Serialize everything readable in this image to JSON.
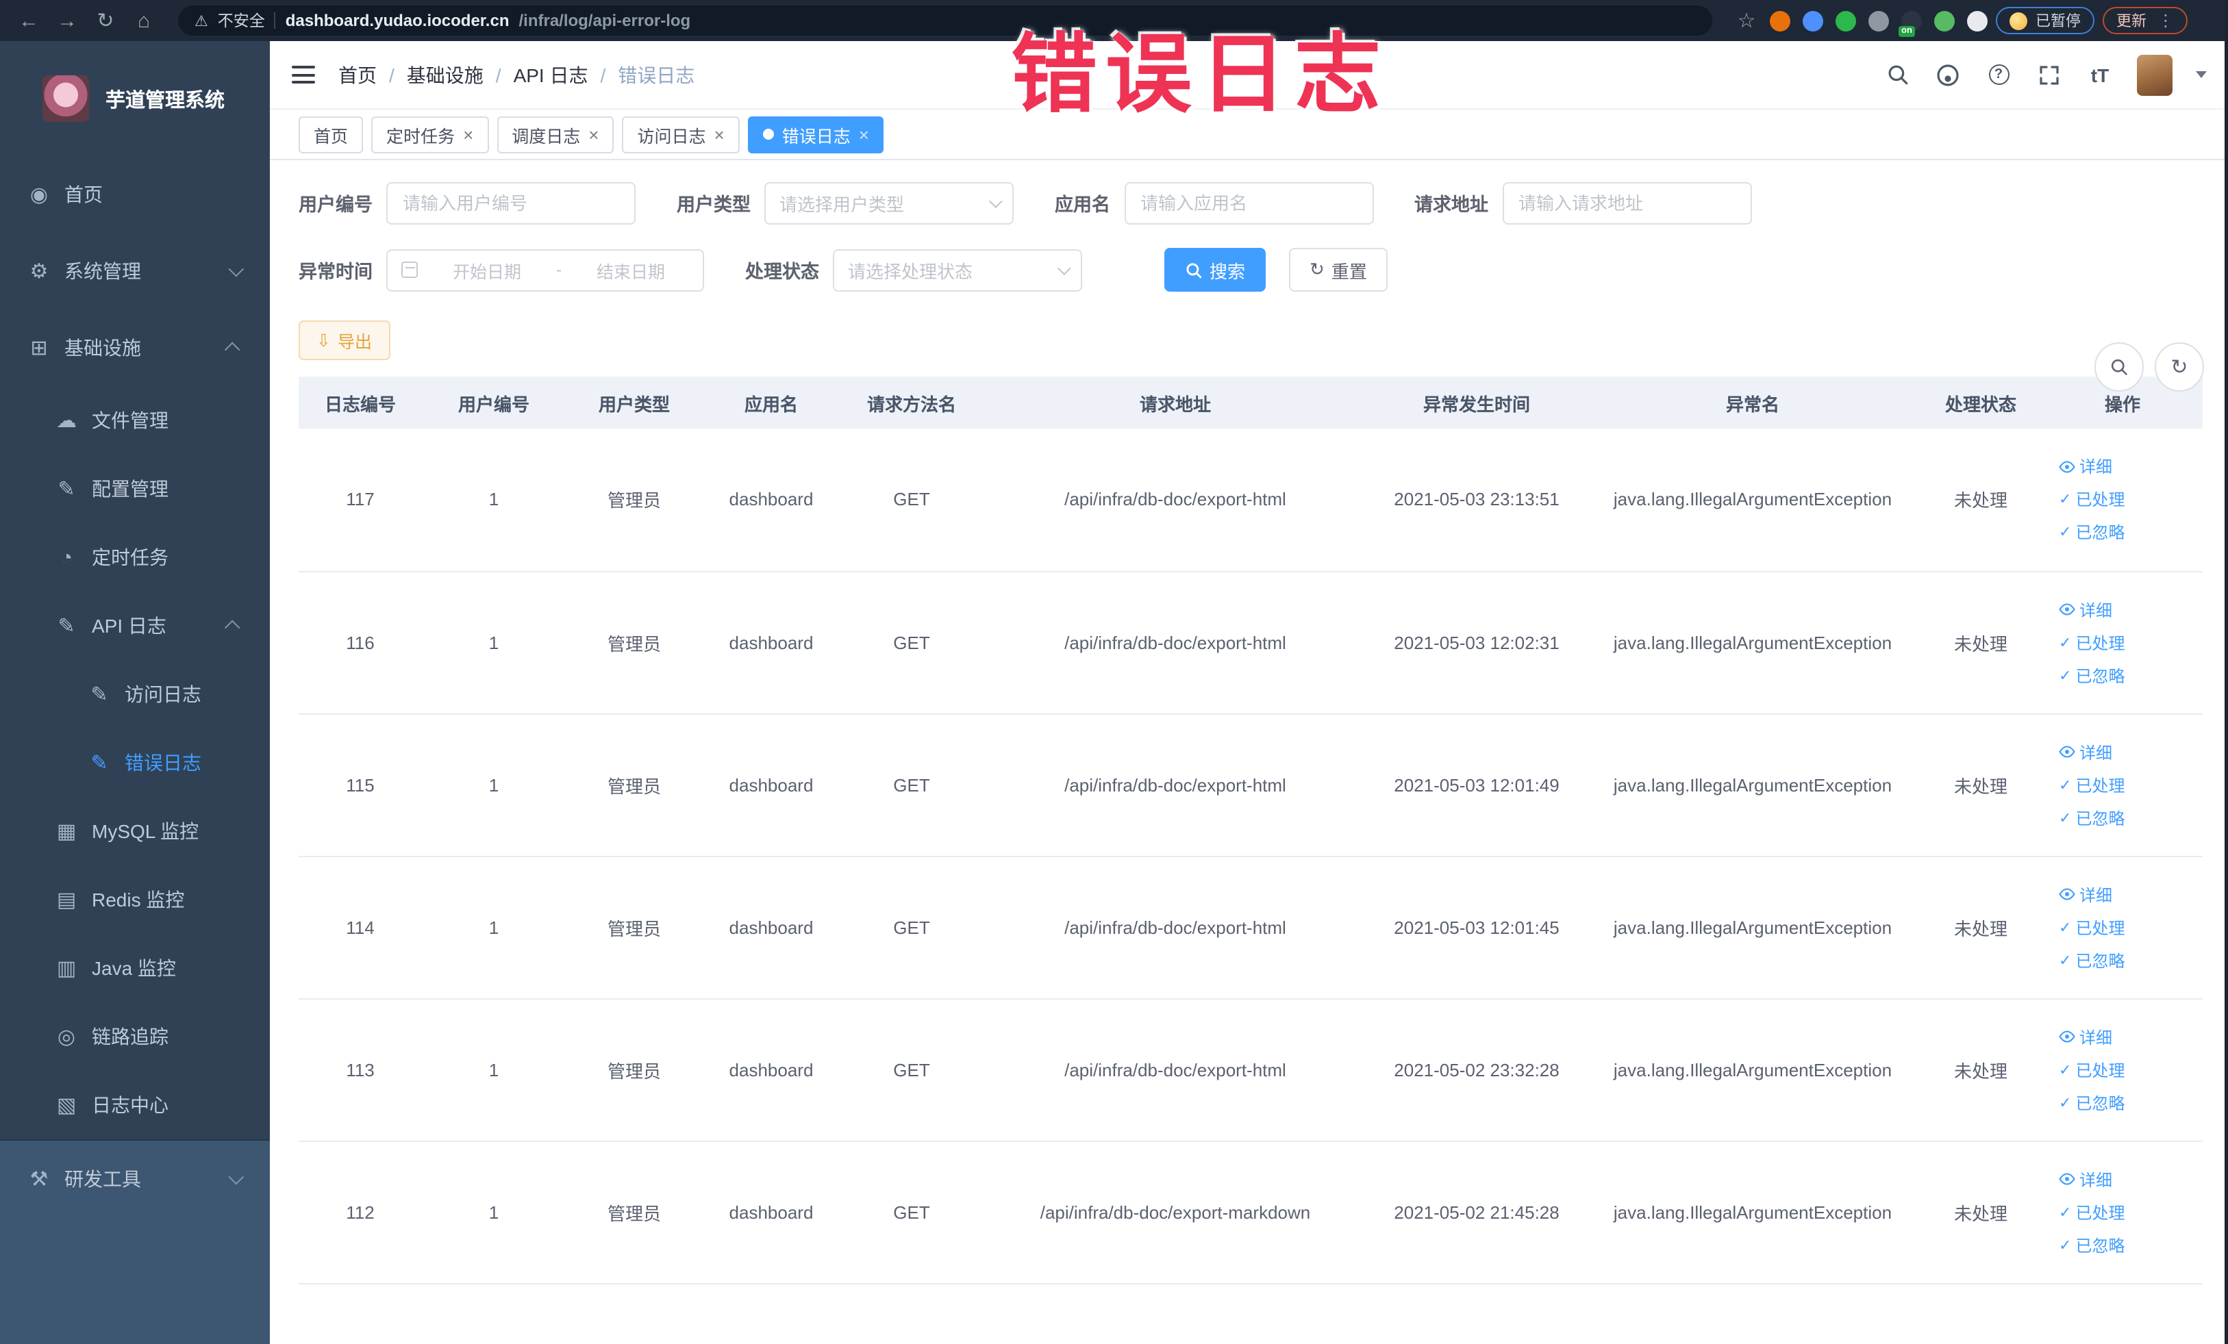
{
  "annotation": {
    "text": "错误日志",
    "color": "#ee3355"
  },
  "colors": {
    "primary": "#409eff",
    "warning": "#e6a23c",
    "sidebar_bg": "#304156",
    "sidebar_light_bg": "#3d5671",
    "browser_bar_bg": "#1e2836"
  },
  "browser": {
    "icons": {
      "back": "←",
      "forward": "→",
      "reload": "↻",
      "home": "⌂",
      "warning": "⚠",
      "star": "☆",
      "menu": "⋮"
    },
    "security_label": "不安全",
    "url_domain": "dashboard.yudao.iocoder.cn",
    "url_path": "/infra/log/api-error-log",
    "extensions": [
      {
        "name": "extension-orange-icon",
        "color": "#e8710a"
      },
      {
        "name": "extension-blue-shield-icon",
        "color": "#4d90fe"
      },
      {
        "name": "extension-green-v-icon",
        "color": "#2db84d"
      },
      {
        "name": "extension-grid-icon",
        "color": "#8f97a3"
      },
      {
        "name": "extension-on-badge-icon",
        "color": "#2b3442",
        "badge": "on"
      },
      {
        "name": "extension-leaf-icon",
        "color": "#57bb63"
      },
      {
        "name": "extension-puzzle-icon",
        "color": "#e8eaed"
      }
    ],
    "paused_label": "已暂停",
    "update_label": "更新"
  },
  "sidebar": {
    "title": "芋道管理系统",
    "items": [
      {
        "key": "home",
        "label": "首页",
        "depth": 0,
        "glyph": "◉",
        "icon": "dashboard-icon"
      },
      {
        "key": "system",
        "label": "系统管理",
        "depth": 0,
        "glyph": "⚙",
        "icon": "gear-icon",
        "arrow": "down"
      },
      {
        "key": "infra",
        "label": "基础设施",
        "depth": 0,
        "glyph": "⊞",
        "icon": "infrastructure-icon",
        "arrow": "up"
      },
      {
        "key": "file",
        "label": "文件管理",
        "depth": 1,
        "glyph": "☁",
        "icon": "cloud-file-icon"
      },
      {
        "key": "config",
        "label": "配置管理",
        "depth": 1,
        "glyph": "✎",
        "icon": "config-edit-icon"
      },
      {
        "key": "job",
        "label": "定时任务",
        "depth": 1,
        "glyph": "◔",
        "icon": "timer-job-icon"
      },
      {
        "key": "api-log",
        "label": "API 日志",
        "depth": 1,
        "glyph": "✎",
        "icon": "api-log-icon",
        "arrow": "up"
      },
      {
        "key": "access-log",
        "label": "访问日志",
        "depth": 2,
        "glyph": "✎",
        "icon": "access-log-icon"
      },
      {
        "key": "error-log",
        "label": "错误日志",
        "depth": 2,
        "glyph": "✎",
        "icon": "error-log-icon",
        "active": true
      },
      {
        "key": "mysql",
        "label": "MySQL 监控",
        "depth": 1,
        "glyph": "▦",
        "icon": "mysql-monitor-icon"
      },
      {
        "key": "redis",
        "label": "Redis 监控",
        "depth": 1,
        "glyph": "▤",
        "icon": "redis-monitor-icon"
      },
      {
        "key": "java",
        "label": "Java 监控",
        "depth": 1,
        "glyph": "▥",
        "icon": "java-monitor-icon"
      },
      {
        "key": "trace",
        "label": "链路追踪",
        "depth": 1,
        "glyph": "◎",
        "icon": "trace-eye-icon"
      },
      {
        "key": "log-center",
        "label": "日志中心",
        "depth": 1,
        "glyph": "▧",
        "icon": "log-center-icon"
      },
      {
        "key": "devtools",
        "label": "研发工具",
        "depth": 0,
        "glyph": "⚒",
        "icon": "devtools-icon",
        "arrow": "down",
        "section": "light"
      }
    ]
  },
  "header": {
    "breadcrumb": {
      "separator": "/",
      "items": [
        {
          "label": "首页"
        },
        {
          "label": "基础设施"
        },
        {
          "label": "API 日志"
        },
        {
          "label": "错误日志"
        }
      ]
    },
    "help_glyph": "?",
    "font_size_glyph": "tT"
  },
  "tabs": {
    "close_glyph": "×",
    "items": [
      {
        "label": "首页",
        "closable": false,
        "active": false
      },
      {
        "label": "定时任务",
        "closable": true,
        "active": false
      },
      {
        "label": "调度日志",
        "closable": true,
        "active": false
      },
      {
        "label": "访问日志",
        "closable": true,
        "active": false
      },
      {
        "label": "错误日志",
        "closable": true,
        "active": true
      }
    ]
  },
  "filters": {
    "user_id": {
      "label": "用户编号",
      "placeholder": "请输入用户编号"
    },
    "user_type": {
      "label": "用户类型",
      "placeholder": "请选择用户类型"
    },
    "app_name": {
      "label": "应用名",
      "placeholder": "请输入应用名"
    },
    "request_url": {
      "label": "请求地址",
      "placeholder": "请输入请求地址"
    },
    "time": {
      "label": "异常时间",
      "start_placeholder": "开始日期",
      "end_placeholder": "结束日期",
      "separator": "-"
    },
    "status": {
      "label": "处理状态",
      "placeholder": "请选择处理状态"
    },
    "search_label": "搜索",
    "reset_label": "重置",
    "reset_icon_glyph": "↻"
  },
  "toolbar": {
    "export_label": "导出",
    "export_icon_glyph": "⇩"
  },
  "table": {
    "columns": [
      "日志编号",
      "用户编号",
      "用户类型",
      "应用名",
      "请求方法名",
      "请求地址",
      "异常发生时间",
      "异常名",
      "处理状态",
      "操作"
    ],
    "fields": [
      "id",
      "user_id",
      "user_type",
      "app_name",
      "method",
      "url",
      "time",
      "exception",
      "status"
    ],
    "rows": [
      {
        "id": "117",
        "user_id": "1",
        "user_type": "管理员",
        "app_name": "dashboard",
        "method": "GET",
        "url": "/api/infra/db-doc/export-html",
        "time": "2021-05-03 23:13:51",
        "exception": "java.lang.IllegalArgumentException",
        "status": "未处理"
      },
      {
        "id": "116",
        "user_id": "1",
        "user_type": "管理员",
        "app_name": "dashboard",
        "method": "GET",
        "url": "/api/infra/db-doc/export-html",
        "time": "2021-05-03 12:02:31",
        "exception": "java.lang.IllegalArgumentException",
        "status": "未处理"
      },
      {
        "id": "115",
        "user_id": "1",
        "user_type": "管理员",
        "app_name": "dashboard",
        "method": "GET",
        "url": "/api/infra/db-doc/export-html",
        "time": "2021-05-03 12:01:49",
        "exception": "java.lang.IllegalArgumentException",
        "status": "未处理"
      },
      {
        "id": "114",
        "user_id": "1",
        "user_type": "管理员",
        "app_name": "dashboard",
        "method": "GET",
        "url": "/api/infra/db-doc/export-html",
        "time": "2021-05-03 12:01:45",
        "exception": "java.lang.IllegalArgumentException",
        "status": "未处理"
      },
      {
        "id": "113",
        "user_id": "1",
        "user_type": "管理员",
        "app_name": "dashboard",
        "method": "GET",
        "url": "/api/infra/db-doc/export-html",
        "time": "2021-05-02 23:32:28",
        "exception": "java.lang.IllegalArgumentException",
        "status": "未处理"
      },
      {
        "id": "112",
        "user_id": "1",
        "user_type": "管理员",
        "app_name": "dashboard",
        "method": "GET",
        "url": "/api/infra/db-doc/export-markdown",
        "time": "2021-05-02 21:45:28",
        "exception": "java.lang.IllegalArgumentException",
        "status": "未处理"
      }
    ],
    "row_actions": [
      {
        "key": "detail",
        "label": "详细",
        "icon": "eye-icon",
        "glyph": ""
      },
      {
        "key": "processed",
        "label": "已处理",
        "icon": "check-icon",
        "glyph": "✓"
      },
      {
        "key": "ignored",
        "label": "已忽略",
        "icon": "check-icon",
        "glyph": "✓"
      }
    ]
  }
}
